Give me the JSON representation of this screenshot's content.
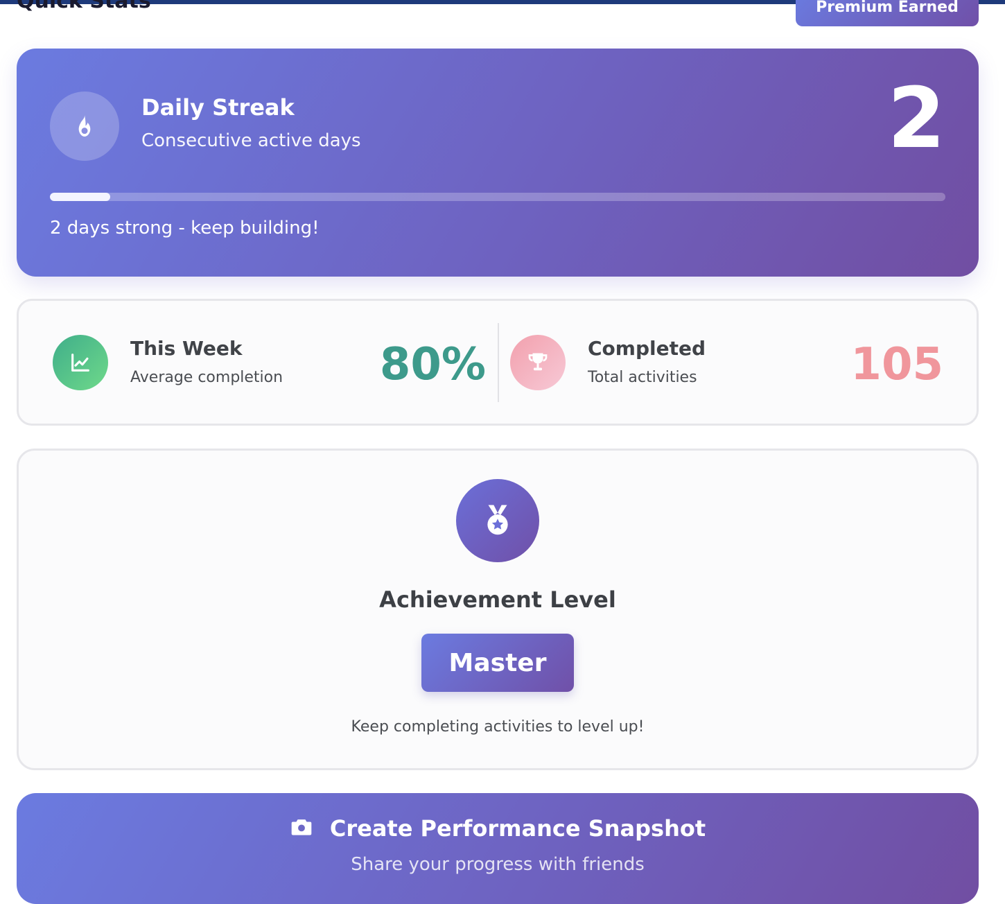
{
  "header": {
    "title": "Quick Stats",
    "premium_label": "Premium Earned"
  },
  "streak": {
    "title": "Daily Streak",
    "subtitle": "Consecutive active days",
    "count": "2",
    "progress": 0.067,
    "message": "2 days strong - keep building!"
  },
  "week": {
    "title": "This Week",
    "subtitle": "Average completion",
    "value": "80%",
    "color": "#3d9a8b"
  },
  "completed": {
    "title": "Completed",
    "subtitle": "Total activities",
    "value": "105",
    "color": "#f0969c"
  },
  "achievement": {
    "title": "Achievement Level",
    "level": "Master",
    "message": "Keep completing activities to level up!"
  },
  "snapshot": {
    "title": "Create Performance Snapshot",
    "subtitle": "Share your progress with friends"
  },
  "icons": {
    "streak": "fire-icon",
    "week": "chart-line-icon",
    "completed": "trophy-icon",
    "achievement": "medal-icon",
    "snapshot": "camera-icon"
  }
}
